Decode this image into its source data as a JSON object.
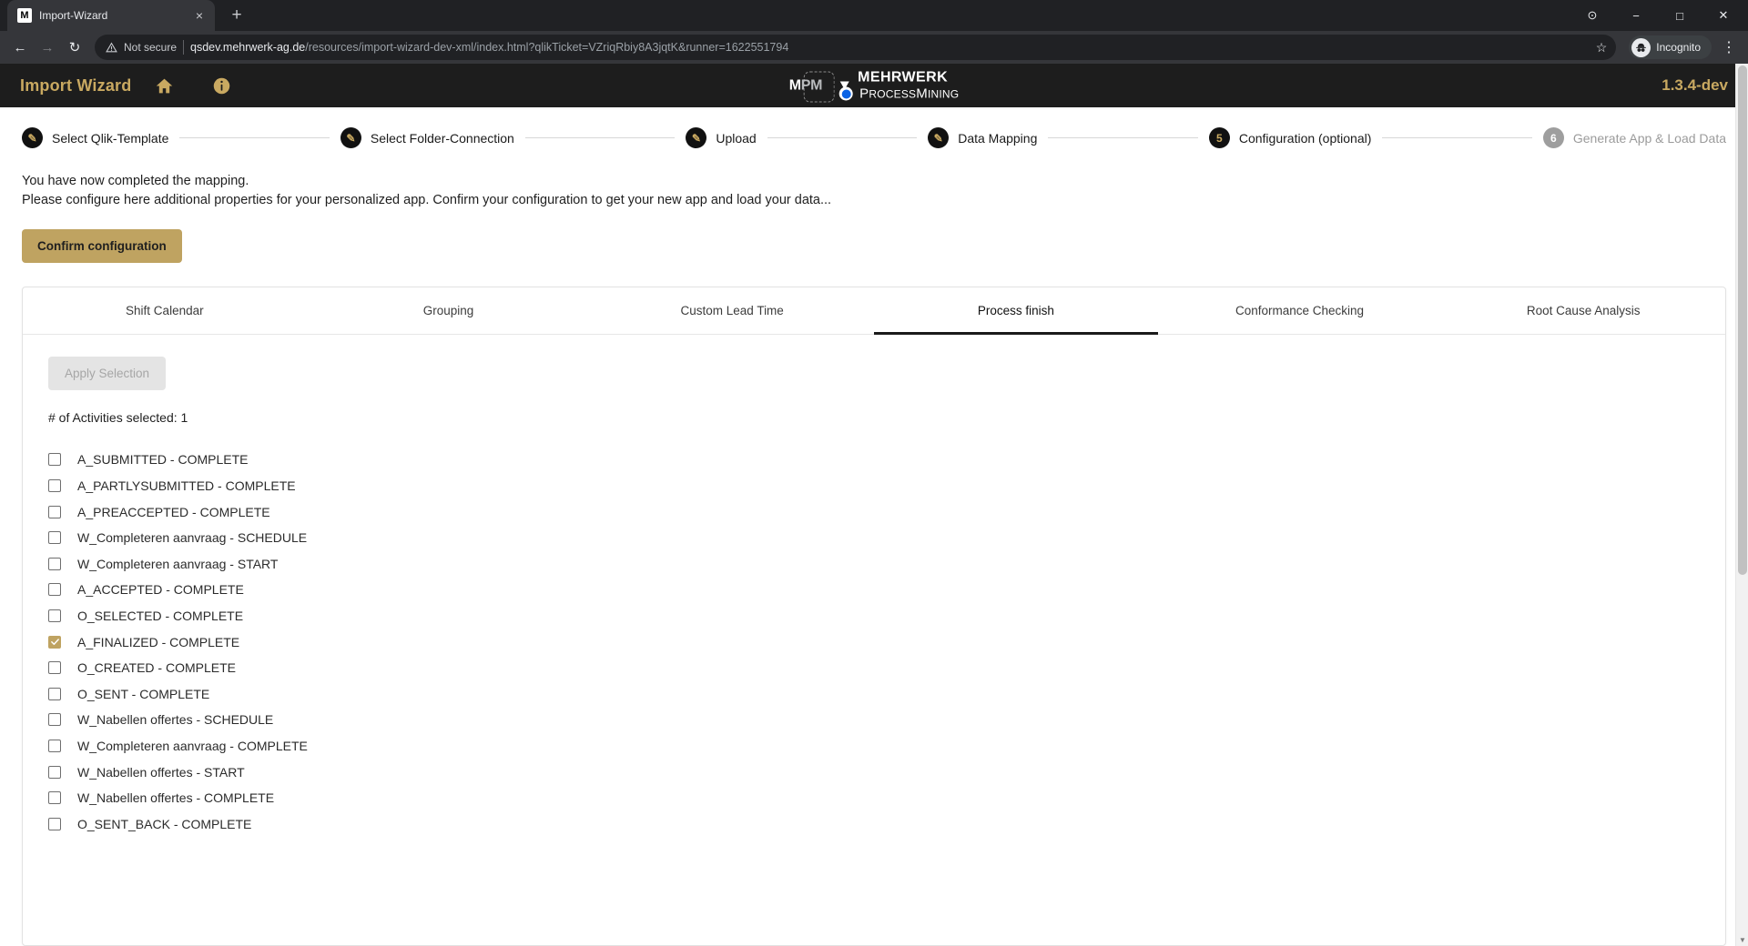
{
  "browser": {
    "tab": {
      "title": "Import-Wizard",
      "favicon_letter": "M",
      "close_label": "×"
    },
    "new_tab_label": "+",
    "window_controls": {
      "minimize": "−",
      "maximize": "□",
      "close": "✕",
      "extra": "⊙"
    },
    "nav": {
      "back": "←",
      "forward": "→",
      "reload": "↻"
    },
    "omnibox": {
      "warning_icon": "warning-triangle-icon",
      "security_label": "Not secure",
      "url_host": "qsdev.mehrwerk-ag.de",
      "url_path": "/resources/import-wizard-dev-xml/index.html?qlikTicket=VZriqRbiy8A3jqtK&runner=1622551794",
      "bookmark_icon": "☆"
    },
    "profile": {
      "label": "Incognito",
      "icon": "incognito-hat-icon"
    },
    "menu_icon": "⋮"
  },
  "app_header": {
    "title": "Import Wizard",
    "home_icon": "home-icon",
    "info_icon": "info-icon",
    "version": "1.3.4-dev",
    "logo": {
      "mark_m": "M",
      "mark_pm": "PM",
      "brand_top": "MEHRWERK",
      "brand_bottom_a": "P",
      "brand_bottom_b": "ROCESS",
      "brand_bottom_c": "M",
      "brand_bottom_d": "INING"
    },
    "colors": {
      "accent": "#c9a961",
      "background": "#1d1d1d"
    }
  },
  "stepper": {
    "steps": [
      {
        "label": "Select Qlik-Template",
        "state": "done",
        "badge": "✎"
      },
      {
        "label": "Select Folder-Connection",
        "state": "done",
        "badge": "✎"
      },
      {
        "label": "Upload",
        "state": "done",
        "badge": "✎"
      },
      {
        "label": "Data Mapping",
        "state": "done",
        "badge": "✎"
      },
      {
        "label": "Configuration (optional)",
        "state": "current",
        "badge": "5"
      },
      {
        "label": "Generate App & Load Data",
        "state": "pending",
        "badge": "6"
      }
    ]
  },
  "intro": {
    "line1": "You have now completed the mapping.",
    "line2": "Please configure here additional properties for your personalized app. Confirm your configuration to get your new app and load your data...",
    "confirm_button": "Confirm configuration"
  },
  "tabs": [
    {
      "label": "Shift Calendar",
      "active": false
    },
    {
      "label": "Grouping",
      "active": false
    },
    {
      "label": "Custom Lead Time",
      "active": false
    },
    {
      "label": "Process finish",
      "active": true
    },
    {
      "label": "Conformance Checking",
      "active": false
    },
    {
      "label": "Root Cause Analysis",
      "active": false
    }
  ],
  "panel": {
    "apply_button": "Apply Selection",
    "apply_button_disabled": true,
    "count_label": "# of Activities selected: 1",
    "checkbox_checked_color": "#bfa361",
    "activities": [
      {
        "label": "A_SUBMITTED - COMPLETE",
        "checked": false
      },
      {
        "label": "A_PARTLYSUBMITTED - COMPLETE",
        "checked": false
      },
      {
        "label": "A_PREACCEPTED - COMPLETE",
        "checked": false
      },
      {
        "label": "W_Completeren aanvraag - SCHEDULE",
        "checked": false
      },
      {
        "label": "W_Completeren aanvraag - START",
        "checked": false
      },
      {
        "label": "A_ACCEPTED - COMPLETE",
        "checked": false
      },
      {
        "label": "O_SELECTED - COMPLETE",
        "checked": false
      },
      {
        "label": "A_FINALIZED - COMPLETE",
        "checked": true
      },
      {
        "label": "O_CREATED - COMPLETE",
        "checked": false
      },
      {
        "label": "O_SENT - COMPLETE",
        "checked": false
      },
      {
        "label": "W_Nabellen offertes - SCHEDULE",
        "checked": false
      },
      {
        "label": "W_Completeren aanvraag - COMPLETE",
        "checked": false
      },
      {
        "label": "W_Nabellen offertes - START",
        "checked": false
      },
      {
        "label": "W_Nabellen offertes - COMPLETE",
        "checked": false
      },
      {
        "label": "O_SENT_BACK - COMPLETE",
        "checked": false
      }
    ]
  }
}
